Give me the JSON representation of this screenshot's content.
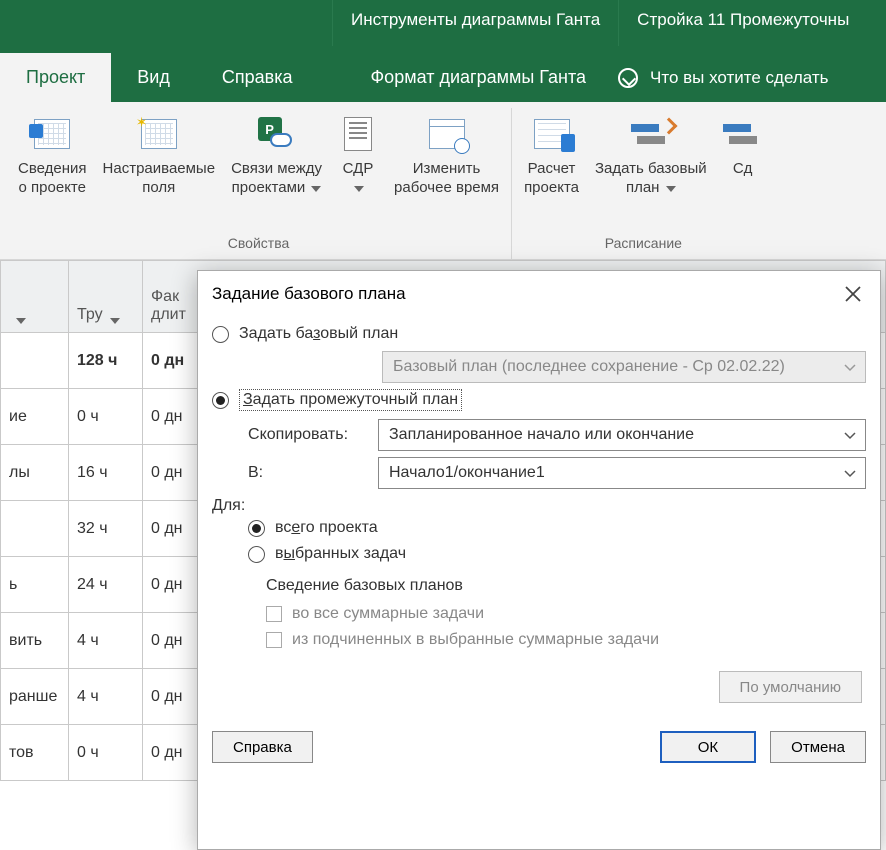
{
  "titlebar": {
    "tool_tab": "Инструменты диаграммы Ганта",
    "doc_title": "Стройка 11 Промежуточны"
  },
  "tabs": {
    "project": "Проект",
    "view": "Вид",
    "help": "Справка",
    "format": "Формат диаграммы Ганта",
    "tellme": "Что вы хотите сделать"
  },
  "ribbon": {
    "group_props": "Свойства",
    "group_sched": "Расписание",
    "items": {
      "info1": "Сведения",
      "info2": "о проекте",
      "custom1": "Настраиваемые",
      "custom2": "поля",
      "links1": "Связи между",
      "links2": "проектами",
      "wbs": "СДР",
      "chgtime1": "Изменить",
      "chgtime2": "рабочее время",
      "calc1": "Расчет",
      "calc2": "проекта",
      "base1": "Задать базовый",
      "base2": "план",
      "move": "Сд"
    }
  },
  "sheet": {
    "headers": {
      "c0": "",
      "c1": "Тру",
      "c2": "Фак\nдлит"
    },
    "rows": [
      {
        "c0": "",
        "c1": "128 ч",
        "c2": "0 дн",
        "bold": true
      },
      {
        "c0": "ие",
        "c1": "0 ч",
        "c2": "0 дн"
      },
      {
        "c0": "лы",
        "c1": "16 ч",
        "c2": "0 дн"
      },
      {
        "c0": "",
        "c1": "32 ч",
        "c2": "0 дн"
      },
      {
        "c0": "ь",
        "c1": "24 ч",
        "c2": "0 дн"
      },
      {
        "c0": "вить",
        "c1": "4 ч",
        "c2": "0 дн"
      },
      {
        "c0": "ранше",
        "c1": "4 ч",
        "c2": "0 дн"
      },
      {
        "c0": "тов",
        "c1": "0 ч",
        "c2": "0 дн"
      }
    ]
  },
  "dialog": {
    "title": "Задание базового плана",
    "opt_baseline_pre": "Задать ба",
    "opt_baseline_ul": "з",
    "opt_baseline_post": "овый план",
    "baseline_combo": "Базовый план (последнее сохранение - Ср 02.02.22)",
    "opt_interim_pre": "",
    "opt_interim_ul": "З",
    "opt_interim_post": "адать промежуточный план",
    "copy_label_pre": "С",
    "copy_label_ul": "к",
    "copy_label_post": "опировать:",
    "copy_value": "Запланированное начало или окончание",
    "into_label_ul": "В",
    "into_label_post": ":",
    "into_value": "Начало1/окончание1",
    "for_label": "Для:",
    "for_all_pre": "вс",
    "for_all_ul": "е",
    "for_all_post": "го проекта",
    "for_sel_pre": "в",
    "for_sel_ul": "ы",
    "for_sel_post": "бранных задач",
    "rollup_title": "Сведение базовых планов",
    "rollup1_pre": "во все су",
    "rollup1_ul": "м",
    "rollup1_post": "марные задачи",
    "rollup2_pre": "",
    "rollup2_ul": "и",
    "rollup2_post": "з подчиненных в выбранные суммарные задачи",
    "btn_default": "По умолчанию",
    "btn_help_pre": "",
    "btn_help_ul": "С",
    "btn_help_post": "правка",
    "btn_ok": "ОК",
    "btn_cancel": "Отмена"
  }
}
